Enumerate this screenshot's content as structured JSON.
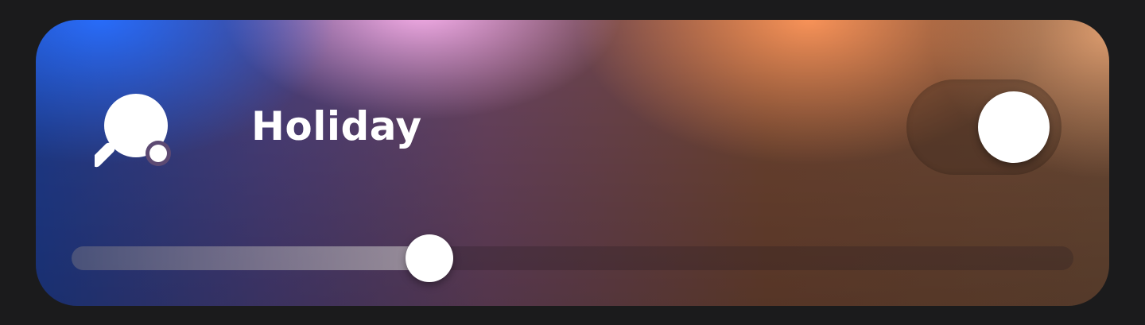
{
  "card": {
    "title": "Holiday",
    "icon": "table-tennis-icon",
    "toggle": {
      "on": true
    },
    "slider": {
      "value": 0.357
    }
  }
}
